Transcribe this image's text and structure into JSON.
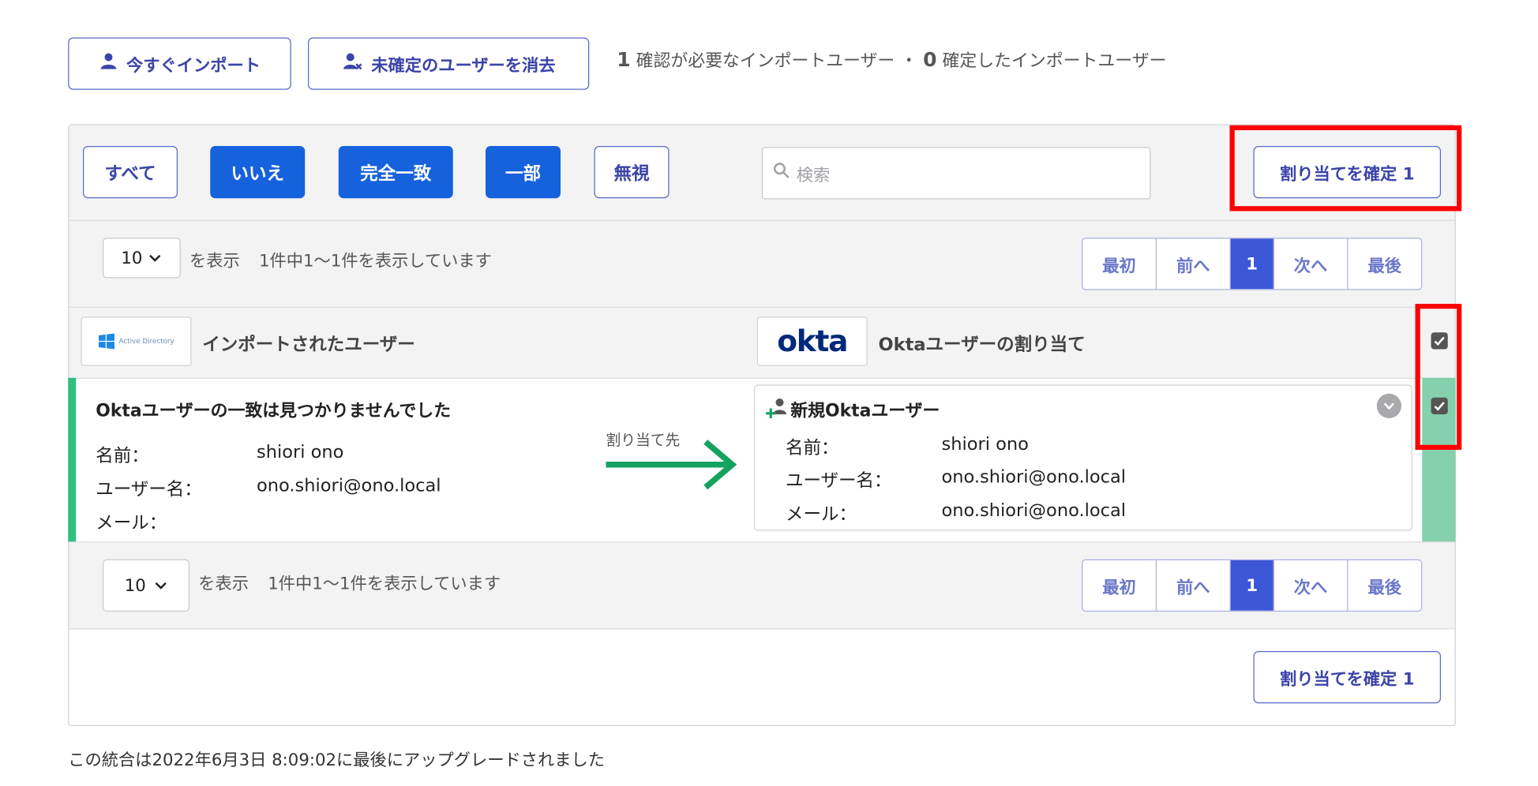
{
  "toolbar": {
    "import_now_label": "今すぐインポート",
    "clear_unconfirmed_label": "未確定のユーザーを消去",
    "status_count_need": "1",
    "status_text_need": "確認が必要なインポートユーザー",
    "status_sep": "・",
    "status_count_confirmed": "0",
    "status_text_confirmed": "確定したインポートユーザー"
  },
  "filters": {
    "all": "すべて",
    "no": "いいえ",
    "exact": "完全一致",
    "partial": "一部",
    "ignore": "無視"
  },
  "search": {
    "placeholder": "検索"
  },
  "confirm_button_label": "割り当てを確定 1",
  "pagination": {
    "page_size": "10",
    "show_label": "を表示",
    "summary": "1件中1～1件を表示しています",
    "first": "最初",
    "prev": "前へ",
    "current": "1",
    "next": "次へ",
    "last": "最後"
  },
  "header": {
    "ad_logo_text": "Active Directory",
    "imported_users_label": "インポートされたユーザー",
    "okta_logo_text": "okta",
    "okta_assign_label": "Oktaユーザーの割り当て"
  },
  "row": {
    "no_match_title": "Oktaユーザーの一致は見つかりませんでした",
    "name_label": "名前：",
    "name_value": "shiori ono",
    "username_label": "ユーザー名：",
    "username_value": "ono.shiori@ono.local",
    "email_label": "メール：",
    "email_value": "",
    "assign_to_label": "割り当て先",
    "new_okta_user_label": "新規Oktaユーザー",
    "card_name_value": "shiori ono",
    "card_username_value": "ono.shiori@ono.local",
    "card_email_value": "ono.shiori@ono.local"
  },
  "footer_note": "この統合は2022年6月3日 8:09:02に最後にアップグレードされました",
  "colors": {
    "accent_blue": "#1662dd",
    "green": "#2fbf7f",
    "highlight_red": "#ff0000"
  }
}
